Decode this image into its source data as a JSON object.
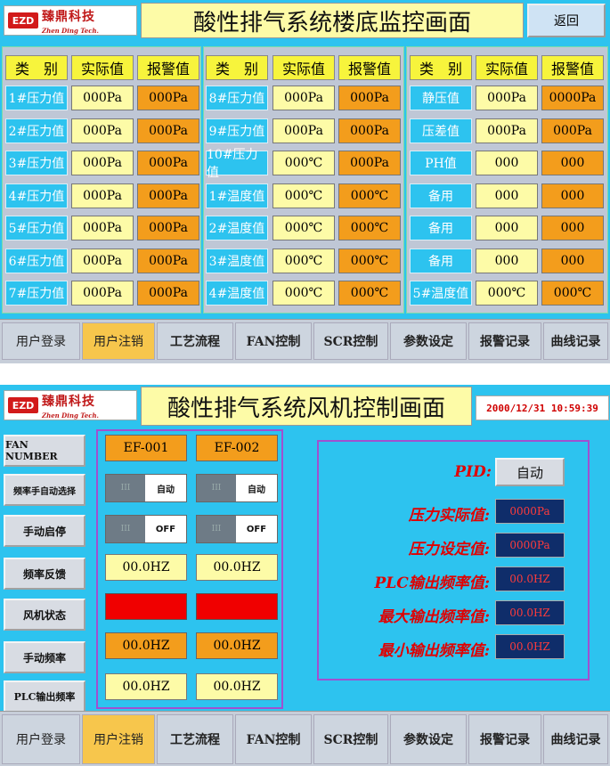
{
  "screen1": {
    "logo": {
      "mark": "EZD",
      "cn": "臻鼎科技",
      "en": "Zhen Ding Tech."
    },
    "title": "酸性排气系统楼底监控画面",
    "back_label": "返回",
    "headers": {
      "type": "类　别",
      "actual": "实际值",
      "alarm": "报警值"
    },
    "col1": [
      {
        "label": "1#压力值",
        "actual": "000Pa",
        "alarm": "000Pa"
      },
      {
        "label": "2#压力值",
        "actual": "000Pa",
        "alarm": "000Pa"
      },
      {
        "label": "3#压力值",
        "actual": "000Pa",
        "alarm": "000Pa"
      },
      {
        "label": "4#压力值",
        "actual": "000Pa",
        "alarm": "000Pa"
      },
      {
        "label": "5#压力值",
        "actual": "000Pa",
        "alarm": "000Pa"
      },
      {
        "label": "6#压力值",
        "actual": "000Pa",
        "alarm": "000Pa"
      },
      {
        "label": "7#压力值",
        "actual": "000Pa",
        "alarm": "000Pa"
      }
    ],
    "col2": [
      {
        "label": "8#压力值",
        "actual": "000Pa",
        "alarm": "000Pa"
      },
      {
        "label": "9#压力值",
        "actual": "000Pa",
        "alarm": "000Pa"
      },
      {
        "label": "10#压力值",
        "actual": "000℃",
        "alarm": "000Pa"
      },
      {
        "label": "1#温度值",
        "actual": "000℃",
        "alarm": "000℃"
      },
      {
        "label": "2#温度值",
        "actual": "000℃",
        "alarm": "000℃"
      },
      {
        "label": "3#温度值",
        "actual": "000℃",
        "alarm": "000℃"
      },
      {
        "label": "4#温度值",
        "actual": "000℃",
        "alarm": "000℃"
      }
    ],
    "col3": [
      {
        "label": "静压值",
        "actual": "000Pa",
        "alarm": "0000Pa"
      },
      {
        "label": "压差值",
        "actual": "000Pa",
        "alarm": "000Pa"
      },
      {
        "label": "PH值",
        "actual": "000",
        "alarm": "000"
      },
      {
        "label": "备用",
        "actual": "000",
        "alarm": "000"
      },
      {
        "label": "备用",
        "actual": "000",
        "alarm": "000"
      },
      {
        "label": "备用",
        "actual": "000",
        "alarm": "000"
      },
      {
        "label": "5#温度值",
        "actual": "000℃",
        "alarm": "000℃"
      }
    ],
    "nav": [
      "用户登录",
      "用户注销",
      "工艺流程",
      "FAN控制",
      "SCR控制",
      "参数设定",
      "报警记录",
      "曲线记录"
    ]
  },
  "screen2": {
    "logo": {
      "mark": "EZD",
      "cn": "臻鼎科技",
      "en": "Zhen Ding Tech."
    },
    "title": "酸性排气系统风机控制画面",
    "datetime": "2000/12/31  10:59:39",
    "side_buttons": [
      "FAN NUMBER",
      "频率手自动选择",
      "手动启停",
      "频率反馈",
      "风机状态",
      "手动频率",
      "PLC输出频率"
    ],
    "fans": [
      {
        "name": "EF-001",
        "mode": "自动",
        "switch": "OFF",
        "feedback": "00.0HZ",
        "manual_freq": "00.0HZ",
        "plc_freq": "00.0HZ",
        "status_color": "#f00000"
      },
      {
        "name": "EF-002",
        "mode": "自动",
        "switch": "OFF",
        "feedback": "00.0HZ",
        "manual_freq": "00.0HZ",
        "plc_freq": "00.0HZ",
        "status_color": "#f00000"
      }
    ],
    "toggle_knob": "III",
    "pid": {
      "label": "PID:",
      "mode": "自动",
      "rows": [
        {
          "label": "压力实际值:",
          "value": "0000Pa"
        },
        {
          "label": "压力设定值:",
          "value": "0000Pa"
        },
        {
          "label": "PLC输出频率值:",
          "value": "00.0HZ"
        },
        {
          "label": "最大输出频率值:",
          "value": "00.0HZ"
        },
        {
          "label": "最小输出频率值:",
          "value": "00.0HZ"
        }
      ]
    },
    "nav": [
      "用户登录",
      "用户注销",
      "工艺流程",
      "FAN控制",
      "SCR控制",
      "参数设定",
      "报警记录",
      "曲线记录"
    ]
  }
}
